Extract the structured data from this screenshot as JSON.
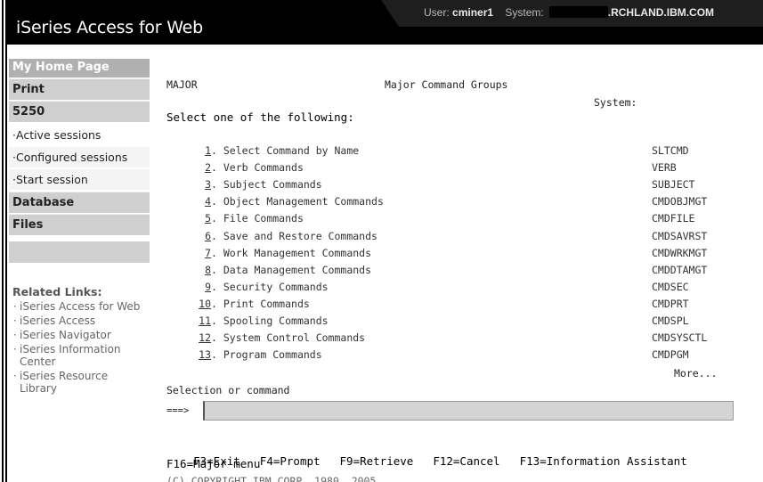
{
  "header": {
    "app_title": "iSeries Access for Web",
    "user_label": "User:",
    "user_name": "cminer1",
    "system_label": "System:",
    "system_name": ".RCHLAND.IBM.COM"
  },
  "sidebar": {
    "home": "My Home Page",
    "sections": [
      "Print",
      "5250",
      "Database",
      "Files"
    ],
    "sub_items": [
      "Active sessions",
      "Configured sessions",
      "Start session"
    ],
    "related_title": "Related Links:",
    "related_links": [
      "iSeries Access for Web",
      "iSeries Access",
      "iSeries Navigator",
      "iSeries Information Center",
      "iSeries Resource Library"
    ]
  },
  "screen": {
    "menu_id": "MAJOR",
    "screen_title": "Major Command Groups",
    "system_label": "System:",
    "prompt": "Select one of the following:",
    "commands": [
      {
        "num": "1",
        "label": "Select Command by Name",
        "code": "SLTCMD"
      },
      {
        "num": "2",
        "label": "Verb Commands",
        "code": "VERB"
      },
      {
        "num": "3",
        "label": "Subject Commands",
        "code": "SUBJECT"
      },
      {
        "num": "4",
        "label": "Object Management Commands",
        "code": "CMDOBJMGT"
      },
      {
        "num": "5",
        "label": "File Commands",
        "code": "CMDFILE"
      },
      {
        "num": "6",
        "label": "Save and Restore Commands",
        "code": "CMDSAVRST"
      },
      {
        "num": "7",
        "label": "Work Management Commands",
        "code": "CMDWRKMGT"
      },
      {
        "num": "8",
        "label": "Data Management Commands",
        "code": "CMDDTAMGT"
      },
      {
        "num": "9",
        "label": "Security Commands",
        "code": "CMDSEC"
      },
      {
        "num": "10",
        "label": "Print Commands",
        "code": "CMDPRT"
      },
      {
        "num": "11",
        "label": "Spooling Commands",
        "code": "CMDSPL"
      },
      {
        "num": "12",
        "label": "System Control Commands",
        "code": "CMDSYSCTL"
      },
      {
        "num": "13",
        "label": "Program Commands",
        "code": "CMDPGM"
      }
    ],
    "more": "More...",
    "selection_label": "Selection or command",
    "arrow": "===>",
    "command_value": "",
    "function_keys": [
      "F3=Exit",
      "F4=Prompt",
      "F9=Retrieve",
      "F12=Cancel",
      "F13=Information Assistant"
    ],
    "function_keys_2": "F16=Major menu",
    "copyright": "(C) COPYRIGHT IBM CORP. 1980, 2005."
  }
}
